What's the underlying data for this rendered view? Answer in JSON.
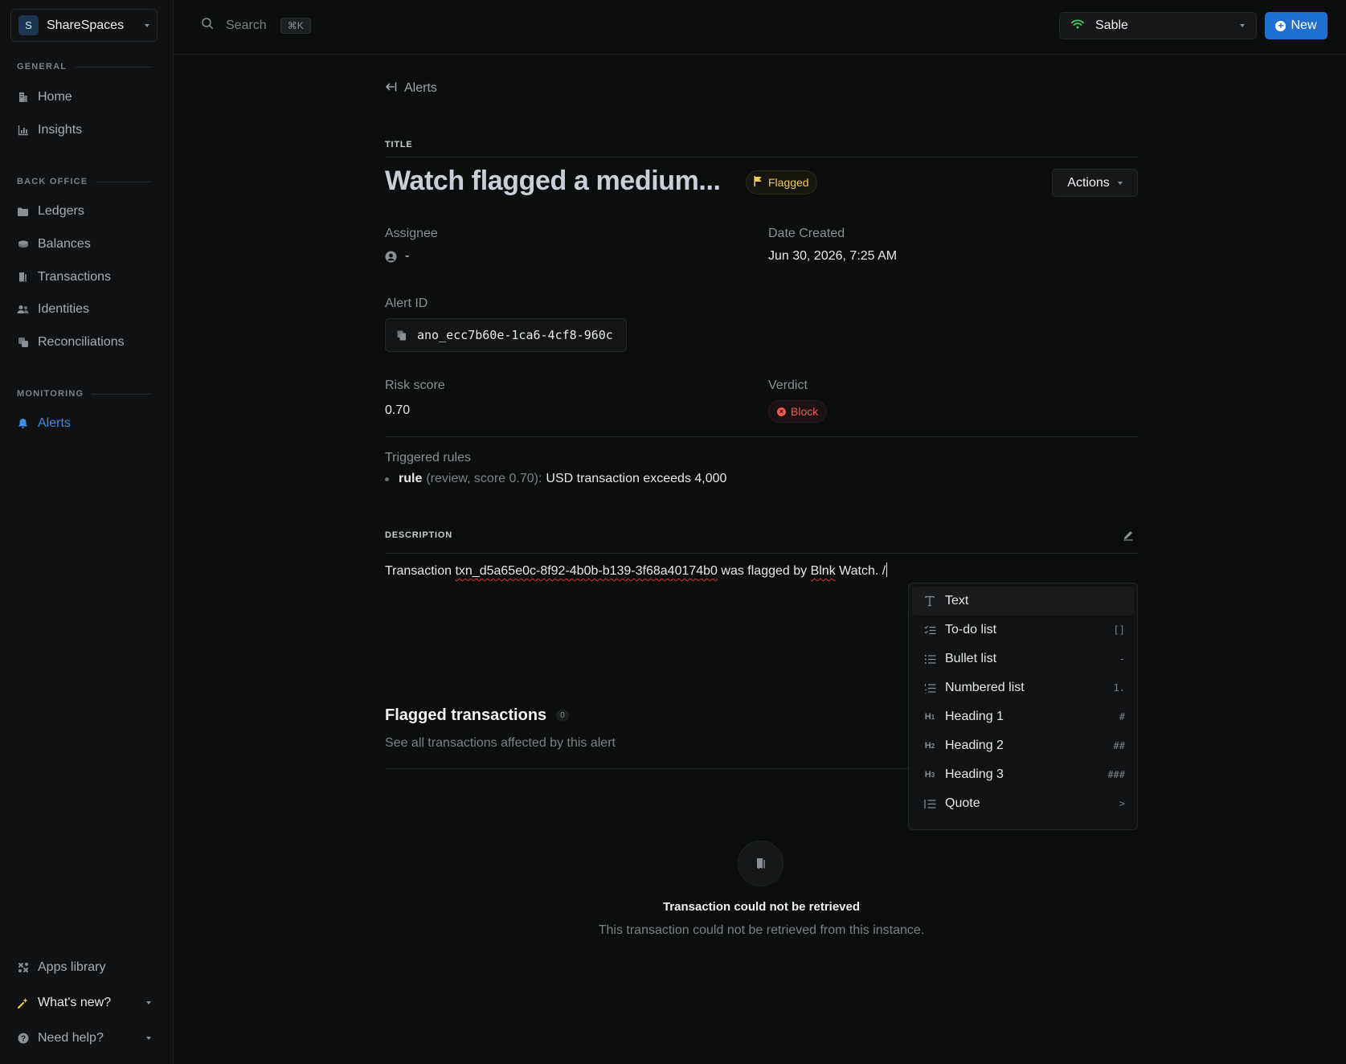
{
  "workspace": {
    "initial": "S",
    "name": "ShareSpaces"
  },
  "sidebar": {
    "sections": [
      {
        "label": "GENERAL",
        "items": [
          {
            "label": "Home",
            "icon": "building-icon"
          },
          {
            "label": "Insights",
            "icon": "bar-chart-icon"
          }
        ]
      },
      {
        "label": "BACK OFFICE",
        "items": [
          {
            "label": "Ledgers",
            "icon": "folder-icon"
          },
          {
            "label": "Balances",
            "icon": "coins-icon"
          },
          {
            "label": "Transactions",
            "icon": "receipt-icon"
          },
          {
            "label": "Identities",
            "icon": "users-icon"
          },
          {
            "label": "Reconciliations",
            "icon": "copy-icon"
          }
        ]
      },
      {
        "label": "MONITORING",
        "items": [
          {
            "label": "Alerts",
            "icon": "bell-icon",
            "active": true
          }
        ]
      }
    ],
    "bottom": [
      {
        "label": "Apps library",
        "icon": "puzzle-icon"
      },
      {
        "label": "What's new?",
        "icon": "sparkle-icon"
      },
      {
        "label": "Need help?",
        "icon": "help-icon"
      }
    ]
  },
  "topbar": {
    "search_label": "Search",
    "search_shortcut": "⌘K",
    "environment": "Sable",
    "new_label": "New"
  },
  "alert": {
    "back_label": "Alerts",
    "title_section": "TITLE",
    "title": "Watch flagged a medium...",
    "status": "Flagged",
    "actions_label": "Actions",
    "assignee_label": "Assignee",
    "assignee_value": "-",
    "date_label": "Date Created",
    "date_value": "Jun 30, 2026, 7:25 AM",
    "alert_id_label": "Alert ID",
    "alert_id_value": "ano_ecc7b60e-1ca6-4cf8-960c",
    "risk_label": "Risk score",
    "risk_value": "0.70",
    "verdict_label": "Verdict",
    "verdict_value": "Block",
    "rules_label": "Triggered rules",
    "rules": [
      {
        "name": "rule",
        "meta": "(review, score 0.70):",
        "desc": "USD transaction exceeds 4,000"
      }
    ],
    "description_section": "DESCRIPTION",
    "description": {
      "prefix": "Transaction ",
      "txn": "txn_d5a65e0c-8f92-4b0b-b139-3f68a40174b0",
      "middle": " was flagged by ",
      "brand": "Blnk",
      "suffix": " Watch. /"
    }
  },
  "flagged": {
    "title": "Flagged transactions",
    "count": "0",
    "subtitle": "See all transactions affected by this alert",
    "empty_title": "Transaction could not be retrieved",
    "empty_subtitle": "This transaction could not be retrieved from this instance."
  },
  "slash_menu": {
    "items": [
      {
        "label": "Text",
        "shortcut": "",
        "icon": "text-icon"
      },
      {
        "label": "To-do list",
        "shortcut": "[]",
        "icon": "todo-list-icon"
      },
      {
        "label": "Bullet list",
        "shortcut": "-",
        "icon": "bullet-list-icon"
      },
      {
        "label": "Numbered list",
        "shortcut": "1.",
        "icon": "numbered-list-icon"
      },
      {
        "label": "Heading 1",
        "shortcut": "#",
        "icon": "heading-1-icon"
      },
      {
        "label": "Heading 2",
        "shortcut": "##",
        "icon": "heading-2-icon"
      },
      {
        "label": "Heading 3",
        "shortcut": "###",
        "icon": "heading-3-icon"
      },
      {
        "label": "Quote",
        "shortcut": ">",
        "icon": "quote-icon"
      }
    ]
  },
  "colors": {
    "accent": "#1f6fd1",
    "flag": "#f2c94c",
    "block": "#ef5d4a",
    "active_nav": "#3b8fe6"
  }
}
